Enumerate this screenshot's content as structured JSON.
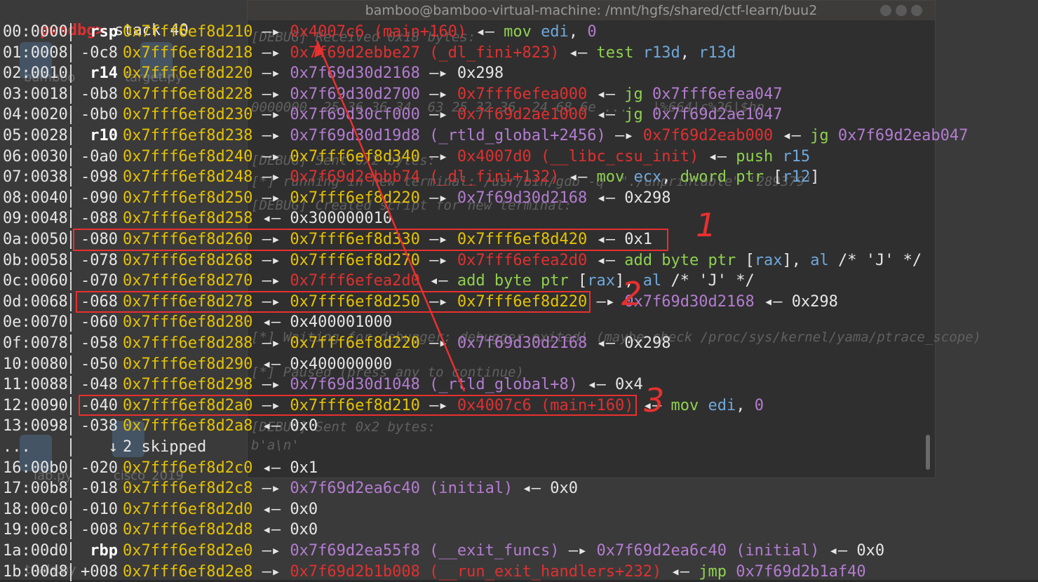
{
  "prompt": {
    "name": "pwndbg>",
    "command": "stack 40"
  },
  "background_window": {
    "title": "bamboo@bamboo-virtual-machine: /mnt/hgfs/shared/ctf-learn/buu2",
    "lines": [
      "[DEBUG] Received 0x18 bytes:",
      "0000000  25 36 36 34  63 25 32 36  24 68 6e ...   |%664|c%26|$hn",
      "[DEBUG] Sent 0x2 bytes:",
      "[*] running in new terminal: /usr/bin/gdb -q  \"./unprintable\" '289379'",
      "[DEBUG] Created script for new terminal:",
      "[*] Waiting for debugger: debugger exited! (maybe check /proc/sys/kernel/yama/ptrace_scope)",
      "[*] Paused (press any to continue)",
      "[DEBUG] Sent 0x2 bytes:",
      "b'a\\n'"
    ]
  },
  "desktop_labels": [
    "bamboo",
    "target.py",
    "lab.py",
    "cisco_2019",
    "trials.py"
  ],
  "rows": [
    {
      "idx": "00:0000",
      "off": "rsp",
      "is_reg": true,
      "segs": [
        [
          "y",
          "0x7fff6ef8d210"
        ],
        [
          "w",
          " —▸ "
        ],
        [
          "r",
          "0x4007c6 (main+160)"
        ],
        [
          "w",
          " ◂— "
        ],
        [
          "g",
          "mov "
        ],
        [
          "b",
          "edi"
        ],
        [
          "w",
          ", "
        ],
        [
          "p",
          "0"
        ]
      ]
    },
    {
      "idx": "01:0008",
      "off": "-0c8",
      "is_reg": false,
      "segs": [
        [
          "y",
          "0x7fff6ef8d218"
        ],
        [
          "w",
          " —▸ "
        ],
        [
          "r",
          "0x7f69d2ebbe27 (_dl_fini+823)"
        ],
        [
          "w",
          " ◂— "
        ],
        [
          "g",
          "test "
        ],
        [
          "b",
          "r13d"
        ],
        [
          "w",
          ", "
        ],
        [
          "b",
          "r13d"
        ]
      ]
    },
    {
      "idx": "02:0010",
      "off": "r14",
      "is_reg": true,
      "segs": [
        [
          "y",
          "0x7fff6ef8d220"
        ],
        [
          "w",
          " —▸ "
        ],
        [
          "p",
          "0x7f69d30d2168"
        ],
        [
          "w",
          " —▸ "
        ],
        [
          "w",
          "0x298"
        ]
      ]
    },
    {
      "idx": "03:0018",
      "off": "-0b8",
      "is_reg": false,
      "segs": [
        [
          "y",
          "0x7fff6ef8d228"
        ],
        [
          "w",
          " —▸ "
        ],
        [
          "p",
          "0x7f69d30d2700"
        ],
        [
          "w",
          " —▸ "
        ],
        [
          "r",
          "0x7fff6efea000"
        ],
        [
          "w",
          " ◂— "
        ],
        [
          "g",
          "jg "
        ],
        [
          "p",
          "0x7fff6efea047"
        ]
      ]
    },
    {
      "idx": "04:0020",
      "off": "-0b0",
      "is_reg": false,
      "segs": [
        [
          "y",
          "0x7fff6ef8d230"
        ],
        [
          "w",
          " —▸ "
        ],
        [
          "p",
          "0x7f69d30cf000"
        ],
        [
          "w",
          " —▸ "
        ],
        [
          "r",
          "0x7f69d2ae1000"
        ],
        [
          "w",
          " ◂— "
        ],
        [
          "g",
          "jg "
        ],
        [
          "p",
          "0x7f69d2ae1047"
        ]
      ]
    },
    {
      "idx": "05:0028",
      "off": "r10",
      "is_reg": true,
      "segs": [
        [
          "y",
          "0x7fff6ef8d238"
        ],
        [
          "w",
          " —▸ "
        ],
        [
          "p",
          "0x7f69d30d19d8 (_rtld_global+2456)"
        ],
        [
          "w",
          " —▸ "
        ],
        [
          "r",
          "0x7f69d2eab000"
        ],
        [
          "w",
          " ◂— "
        ],
        [
          "g",
          "jg "
        ],
        [
          "p",
          "0x7f69d2eab047"
        ]
      ]
    },
    {
      "idx": "06:0030",
      "off": "-0a0",
      "is_reg": false,
      "segs": [
        [
          "y",
          "0x7fff6ef8d240"
        ],
        [
          "w",
          " —▸ "
        ],
        [
          "y",
          "0x7fff6ef8d340"
        ],
        [
          "w",
          " —▸ "
        ],
        [
          "r",
          "0x4007d0 (__libc_csu_init)"
        ],
        [
          "w",
          " ◂— "
        ],
        [
          "g",
          "push "
        ],
        [
          "b",
          "r15"
        ]
      ]
    },
    {
      "idx": "07:0038",
      "off": "-098",
      "is_reg": false,
      "segs": [
        [
          "y",
          "0x7fff6ef8d248"
        ],
        [
          "w",
          " —▸ "
        ],
        [
          "r",
          "0x7f69d2ebbb74 (_dl_fini+132)"
        ],
        [
          "w",
          " ◂— "
        ],
        [
          "g",
          "mov "
        ],
        [
          "b",
          "ecx"
        ],
        [
          "w",
          ", "
        ],
        [
          "g",
          "dword ptr "
        ],
        [
          "w",
          "["
        ],
        [
          "b",
          "r12"
        ],
        [
          "w",
          "]"
        ]
      ]
    },
    {
      "idx": "08:0040",
      "off": "-090",
      "is_reg": false,
      "segs": [
        [
          "y",
          "0x7fff6ef8d250"
        ],
        [
          "w",
          " —▸ "
        ],
        [
          "y",
          "0x7fff6ef8d220"
        ],
        [
          "w",
          " —▸ "
        ],
        [
          "p",
          "0x7f69d30d2168"
        ],
        [
          "w",
          " ◂— "
        ],
        [
          "w",
          "0x298"
        ]
      ]
    },
    {
      "idx": "09:0048",
      "off": "-088",
      "is_reg": false,
      "segs": [
        [
          "y",
          "0x7fff6ef8d258"
        ],
        [
          "w",
          " ◂— "
        ],
        [
          "w",
          "0x300000010"
        ]
      ]
    },
    {
      "idx": "0a:0050",
      "off": "-080",
      "is_reg": false,
      "segs": [
        [
          "y",
          "0x7fff6ef8d260"
        ],
        [
          "w",
          " —▸ "
        ],
        [
          "y",
          "0x7fff6ef8d330"
        ],
        [
          "w",
          " —▸ "
        ],
        [
          "y",
          "0x7fff6ef8d420"
        ],
        [
          "w",
          " ◂— "
        ],
        [
          "w",
          "0x1"
        ]
      ]
    },
    {
      "idx": "0b:0058",
      "off": "-078",
      "is_reg": false,
      "segs": [
        [
          "y",
          "0x7fff6ef8d268"
        ],
        [
          "w",
          " —▸ "
        ],
        [
          "y",
          "0x7fff6ef8d270"
        ],
        [
          "w",
          " —▸ "
        ],
        [
          "r",
          "0x7fff6efea2d0"
        ],
        [
          "w",
          " ◂— "
        ],
        [
          "g",
          "add "
        ],
        [
          "g",
          "byte ptr "
        ],
        [
          "w",
          "["
        ],
        [
          "b",
          "rax"
        ],
        [
          "w",
          "], "
        ],
        [
          "b",
          "al"
        ],
        [
          "w",
          " /* 'J' */"
        ]
      ]
    },
    {
      "idx": "0c:0060",
      "off": "-070",
      "is_reg": false,
      "segs": [
        [
          "y",
          "0x7fff6ef8d270"
        ],
        [
          "w",
          " —▸ "
        ],
        [
          "r",
          "0x7fff6efea2d0"
        ],
        [
          "w",
          " ◂— "
        ],
        [
          "g",
          "add "
        ],
        [
          "g",
          "byte ptr "
        ],
        [
          "w",
          "["
        ],
        [
          "b",
          "rax"
        ],
        [
          "w",
          "], "
        ],
        [
          "b",
          "al"
        ],
        [
          "w",
          " /* 'J' */"
        ]
      ]
    },
    {
      "idx": "0d:0068",
      "off": "-068",
      "is_reg": false,
      "segs": [
        [
          "y",
          "0x7fff6ef8d278"
        ],
        [
          "w",
          " —▸ "
        ],
        [
          "y",
          "0x7fff6ef8d250"
        ],
        [
          "w",
          " —▸ "
        ],
        [
          "y",
          "0x7fff6ef8d220"
        ],
        [
          "w",
          " —▸ "
        ],
        [
          "p",
          "0x7f69d30d2168"
        ],
        [
          "w",
          " ◂— "
        ],
        [
          "w",
          "0x298"
        ]
      ]
    },
    {
      "idx": "0e:0070",
      "off": "-060",
      "is_reg": false,
      "segs": [
        [
          "y",
          "0x7fff6ef8d280"
        ],
        [
          "w",
          " ◂— "
        ],
        [
          "w",
          "0x400001000"
        ]
      ]
    },
    {
      "idx": "0f:0078",
      "off": "-058",
      "is_reg": false,
      "segs": [
        [
          "y",
          "0x7fff6ef8d288"
        ],
        [
          "w",
          " —▸ "
        ],
        [
          "y",
          "0x7fff6ef8d220"
        ],
        [
          "w",
          " —▸ "
        ],
        [
          "p",
          "0x7f69d30d2168"
        ],
        [
          "w",
          " ◂— "
        ],
        [
          "w",
          "0x298"
        ]
      ]
    },
    {
      "idx": "10:0080",
      "off": "-050",
      "is_reg": false,
      "segs": [
        [
          "y",
          "0x7fff6ef8d290"
        ],
        [
          "w",
          " ◂— "
        ],
        [
          "w",
          "0x400000000"
        ]
      ]
    },
    {
      "idx": "11:0088",
      "off": "-048",
      "is_reg": false,
      "segs": [
        [
          "y",
          "0x7fff6ef8d298"
        ],
        [
          "w",
          " —▸ "
        ],
        [
          "p",
          "0x7f69d30d1048 (_rtld_global+8)"
        ],
        [
          "w",
          " ◂— "
        ],
        [
          "w",
          "0x4"
        ]
      ]
    },
    {
      "idx": "12:0090",
      "off": "-040",
      "is_reg": false,
      "segs": [
        [
          "y",
          "0x7fff6ef8d2a0"
        ],
        [
          "w",
          " —▸ "
        ],
        [
          "y",
          "0x7fff6ef8d210"
        ],
        [
          "w",
          " —▸ "
        ],
        [
          "r",
          "0x4007c6 (main+160)"
        ],
        [
          "w",
          " ◂— "
        ],
        [
          "g",
          "mov "
        ],
        [
          "b",
          "edi"
        ],
        [
          "w",
          ", "
        ],
        [
          "p",
          "0"
        ]
      ]
    },
    {
      "idx": "13:0098",
      "off": "-038",
      "is_reg": false,
      "segs": [
        [
          "y",
          "0x7fff6ef8d2a8"
        ],
        [
          "w",
          " ◂— "
        ],
        [
          "w",
          "0x0"
        ]
      ]
    },
    {
      "idx": "...",
      "off": "↓",
      "is_reg": false,
      "segs": [
        [
          "w",
          "2 skipped"
        ]
      ]
    },
    {
      "idx": "16:00b0",
      "off": "-020",
      "is_reg": false,
      "segs": [
        [
          "y",
          "0x7fff6ef8d2c0"
        ],
        [
          "w",
          " ◂— "
        ],
        [
          "w",
          "0x1"
        ]
      ]
    },
    {
      "idx": "17:00b8",
      "off": "-018",
      "is_reg": false,
      "segs": [
        [
          "y",
          "0x7fff6ef8d2c8"
        ],
        [
          "w",
          " —▸ "
        ],
        [
          "p",
          "0x7f69d2ea6c40 (initial)"
        ],
        [
          "w",
          " ◂— "
        ],
        [
          "w",
          "0x0"
        ]
      ]
    },
    {
      "idx": "18:00c0",
      "off": "-010",
      "is_reg": false,
      "segs": [
        [
          "y",
          "0x7fff6ef8d2d0"
        ],
        [
          "w",
          " ◂— "
        ],
        [
          "w",
          "0x0"
        ]
      ]
    },
    {
      "idx": "19:00c8",
      "off": "-008",
      "is_reg": false,
      "segs": [
        [
          "y",
          "0x7fff6ef8d2d8"
        ],
        [
          "w",
          " ◂— "
        ],
        [
          "w",
          "0x0"
        ]
      ]
    },
    {
      "idx": "1a:00d0",
      "off": "rbp",
      "is_reg": true,
      "segs": [
        [
          "y",
          "0x7fff6ef8d2e0"
        ],
        [
          "w",
          " —▸ "
        ],
        [
          "p",
          "0x7f69d2ea55f8 (__exit_funcs)"
        ],
        [
          "w",
          " —▸ "
        ],
        [
          "p",
          "0x7f69d2ea6c40 (initial)"
        ],
        [
          "w",
          " ◂— "
        ],
        [
          "w",
          "0x0"
        ]
      ]
    },
    {
      "idx": "1b:00d8",
      "off": "+008",
      "is_reg": false,
      "segs": [
        [
          "y",
          "0x7fff6ef8d2e8"
        ],
        [
          "w",
          " —▸ "
        ],
        [
          "r",
          "0x7f69d2b1b008 (__run_exit_handlers+232)"
        ],
        [
          "w",
          " ◂— "
        ],
        [
          "g",
          "jmp "
        ],
        [
          "p",
          "0x7f69d2b1af40"
        ]
      ]
    }
  ],
  "annotations": {
    "note1": "1",
    "note2": "2",
    "note3": "3"
  },
  "colors": {
    "highlight": "#e8302f",
    "address": "#e6c200",
    "code": "#e03030",
    "data": "#b47cd1",
    "instr": "#8fd14f",
    "register": "#6fa8dc"
  }
}
